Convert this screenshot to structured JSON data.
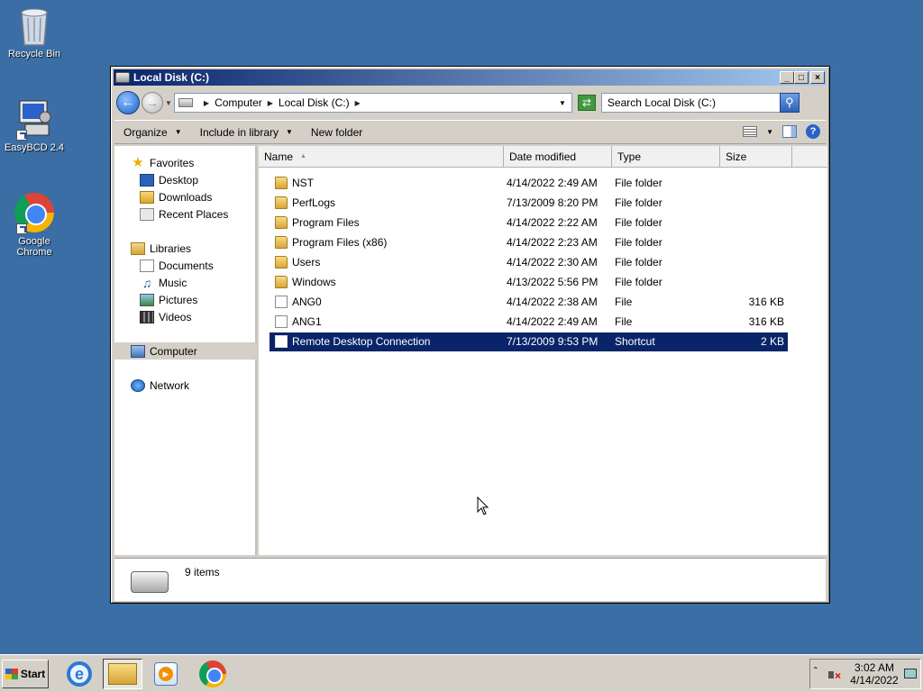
{
  "desktop": {
    "icons": [
      {
        "label": "Recycle Bin",
        "icon": "recycle-bin-icon"
      },
      {
        "label": "EasyBCD 2.4",
        "icon": "easybcd-icon"
      },
      {
        "label": "Google Chrome",
        "icon": "chrome-icon"
      }
    ]
  },
  "window": {
    "title": "Local Disk (C:)",
    "controls": {
      "minimize": "_",
      "maximize": "□",
      "close": "×"
    }
  },
  "address_bar": {
    "crumbs": [
      "Computer",
      "Local Disk (C:)"
    ],
    "search_placeholder": "Search Local Disk (C:)"
  },
  "command_bar": {
    "organize": "Organize",
    "include": "Include in library",
    "new_folder": "New folder"
  },
  "nav_pane": {
    "favorites": {
      "label": "Favorites",
      "items": [
        "Desktop",
        "Downloads",
        "Recent Places"
      ]
    },
    "libraries": {
      "label": "Libraries",
      "items": [
        "Documents",
        "Music",
        "Pictures",
        "Videos"
      ]
    },
    "computer": "Computer",
    "network": "Network"
  },
  "file_list": {
    "columns": [
      "Name",
      "Date modified",
      "Type",
      "Size"
    ],
    "rows": [
      {
        "name": "NST",
        "date": "4/14/2022 2:49 AM",
        "type": "File folder",
        "size": "",
        "kind": "folder"
      },
      {
        "name": "PerfLogs",
        "date": "7/13/2009 8:20 PM",
        "type": "File folder",
        "size": "",
        "kind": "folder"
      },
      {
        "name": "Program Files",
        "date": "4/14/2022 2:22 AM",
        "type": "File folder",
        "size": "",
        "kind": "folder"
      },
      {
        "name": "Program Files (x86)",
        "date": "4/14/2022 2:23 AM",
        "type": "File folder",
        "size": "",
        "kind": "folder"
      },
      {
        "name": "Users",
        "date": "4/14/2022 2:30 AM",
        "type": "File folder",
        "size": "",
        "kind": "folder"
      },
      {
        "name": "Windows",
        "date": "4/13/2022 5:56 PM",
        "type": "File folder",
        "size": "",
        "kind": "folder"
      },
      {
        "name": "ANG0",
        "date": "4/14/2022 2:38 AM",
        "type": "File",
        "size": "316 KB",
        "kind": "file"
      },
      {
        "name": "ANG1",
        "date": "4/14/2022 2:49 AM",
        "type": "File",
        "size": "316 KB",
        "kind": "file"
      },
      {
        "name": "Remote Desktop Connection",
        "date": "7/13/2009 9:53 PM",
        "type": "Shortcut",
        "size": "2 KB",
        "kind": "file",
        "selected": true
      }
    ]
  },
  "details_pane": {
    "item_count": "9 items"
  },
  "taskbar": {
    "start_label": "Start",
    "clock_time": "3:02 AM",
    "clock_date": "4/14/2022"
  }
}
